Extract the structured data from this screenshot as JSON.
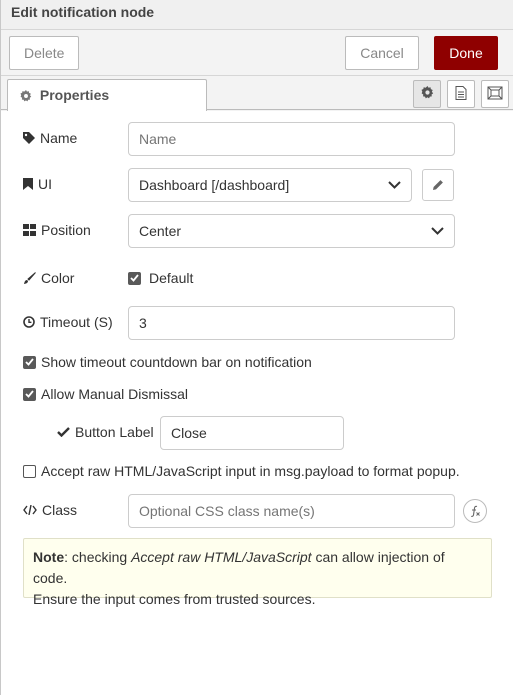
{
  "window": {
    "title": "Edit notification node"
  },
  "toolbar": {
    "delete_label": "Delete",
    "cancel_label": "Cancel",
    "done_label": "Done"
  },
  "tabs": {
    "properties_label": "Properties"
  },
  "form": {
    "name": {
      "label": "Name",
      "placeholder": "Name",
      "value": ""
    },
    "ui": {
      "label": "UI",
      "value": "Dashboard [/dashboard]"
    },
    "position": {
      "label": "Position",
      "value": "Center"
    },
    "color": {
      "label": "Color",
      "checkbox_label": "Default",
      "checked": true
    },
    "timeout": {
      "label": "Timeout (S)",
      "value": "3"
    },
    "show_countdown": {
      "label": "Show timeout countdown bar on notification",
      "checked": true
    },
    "allow_dismissal": {
      "label": "Allow Manual Dismissal",
      "checked": true
    },
    "button_label": {
      "label": "Button Label",
      "value": "Close"
    },
    "raw_html": {
      "label": "Accept raw HTML/JavaScript input in msg.payload to format popup.",
      "checked": false
    },
    "class_field": {
      "label": "Class",
      "placeholder": "Optional CSS class name(s)"
    }
  },
  "note": {
    "bold": "Note",
    "text1": ": checking ",
    "italic": "Accept raw HTML/JavaScript",
    "text2": " can allow injection of code.",
    "line2": "Ensure the input comes from trusted sources."
  },
  "colors": {
    "done_button": "#8f0000",
    "checkbox": "#595959",
    "note_bg": "#ffffee"
  }
}
